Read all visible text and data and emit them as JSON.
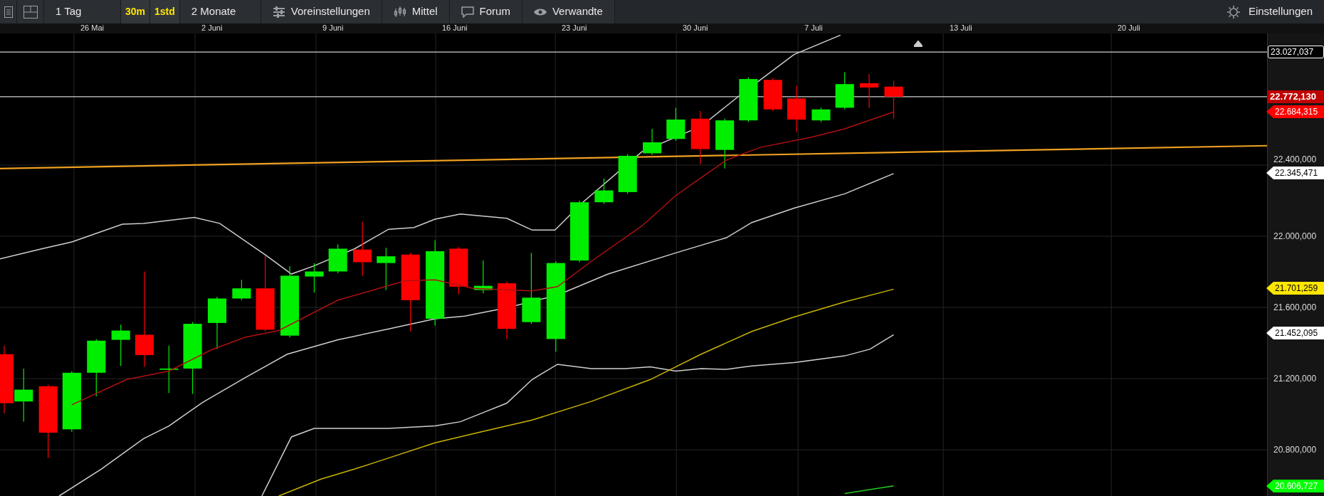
{
  "toolbar": {
    "range": "1 Tag",
    "intervals": [
      {
        "label": "30m",
        "selected": true
      },
      {
        "label": "1std",
        "selected": true
      }
    ],
    "period": "2 Monate",
    "menus": [
      {
        "kind": "sliders",
        "label": "Voreinstellungen"
      },
      {
        "kind": "candles",
        "label": "Mittel"
      },
      {
        "kind": "chat",
        "label": "Forum"
      },
      {
        "kind": "eye",
        "label": "Verwandte"
      }
    ],
    "settings": "Einstellungen"
  },
  "chart": {
    "x_labels": [
      "26 Mai",
      "2 Juni",
      "9 Juni",
      "16 Juni",
      "23 Juni",
      "30 Juni",
      "7 Juli",
      "13 Juli",
      "20 Juli"
    ],
    "y_labels": [
      "22.400,000",
      "22.000,000",
      "21.600,000",
      "21.200,000",
      "20.800,000"
    ],
    "price_tags": [
      {
        "value": "23.027,037",
        "color": "#ffffff",
        "kind": "outline"
      },
      {
        "value": "22.772,130",
        "color": "#c00000",
        "kind": "box"
      },
      {
        "value": "22.684,315",
        "color": "#ff0000",
        "kind": "arrow"
      },
      {
        "value": "22.345,471",
        "color": "#ffffff",
        "kind": "arrow"
      },
      {
        "value": "21.701,259",
        "color": "#ffe600",
        "kind": "arrow"
      },
      {
        "value": "21.452,095",
        "color": "#ffffff",
        "kind": "arrow"
      },
      {
        "value": "20.606,727",
        "color": "#00ff00",
        "kind": "arrow"
      }
    ]
  }
}
